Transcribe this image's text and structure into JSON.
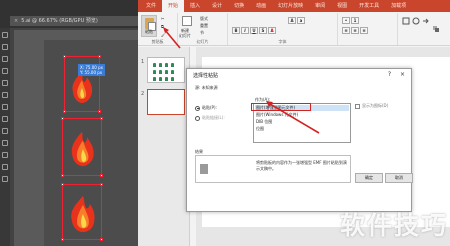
{
  "illustrator": {
    "tab_title": "5.ai @ 66.67% (RGB/GPU 预览)",
    "tab_close": "×",
    "coord_tip": "X: 75.00 px\nY: 55.00 px"
  },
  "powerpoint": {
    "ribbon_tabs": [
      "文件",
      "开始",
      "插入",
      "设计",
      "切换",
      "动画",
      "幻灯片放映",
      "审阅",
      "视图",
      "开发工具",
      "加载项"
    ],
    "active_tab_index": 1,
    "clipboard_group": {
      "paste_label": "粘贴",
      "group_label": "剪贴板"
    },
    "slides_group": {
      "new_slide": "新建",
      "new_slide2": "幻灯片",
      "group_label": "幻灯片",
      "layout": "版式",
      "reset": "重置",
      "section": "节"
    },
    "font_group": {
      "group_label": "字体"
    },
    "slides": [
      {
        "number": "1"
      },
      {
        "number": "2"
      }
    ]
  },
  "dialog": {
    "title": "选择性粘贴",
    "help": "?",
    "close": "×",
    "source_label": "源: 未知来源",
    "as_label": "作为(A):",
    "radio_paste": "粘贴(P):",
    "radio_link": "粘贴链接(L):",
    "options": [
      "图片(增强型图元文件)",
      "图片(Windows 元文件)",
      "DIB 位图",
      "位图"
    ],
    "selected_index": 0,
    "display_as_icon": "显示为图标(D)",
    "result_label": "结果",
    "result_text": "将剪贴板的内容作为一张增强型 EMF 图片粘贴到演示文稿中。",
    "ok": "确定",
    "cancel": "取消"
  },
  "watermark": "软件技巧",
  "colors": {
    "ppt_accent": "#c9462c",
    "highlight": "#d32222",
    "ai_bg": "#434343"
  }
}
